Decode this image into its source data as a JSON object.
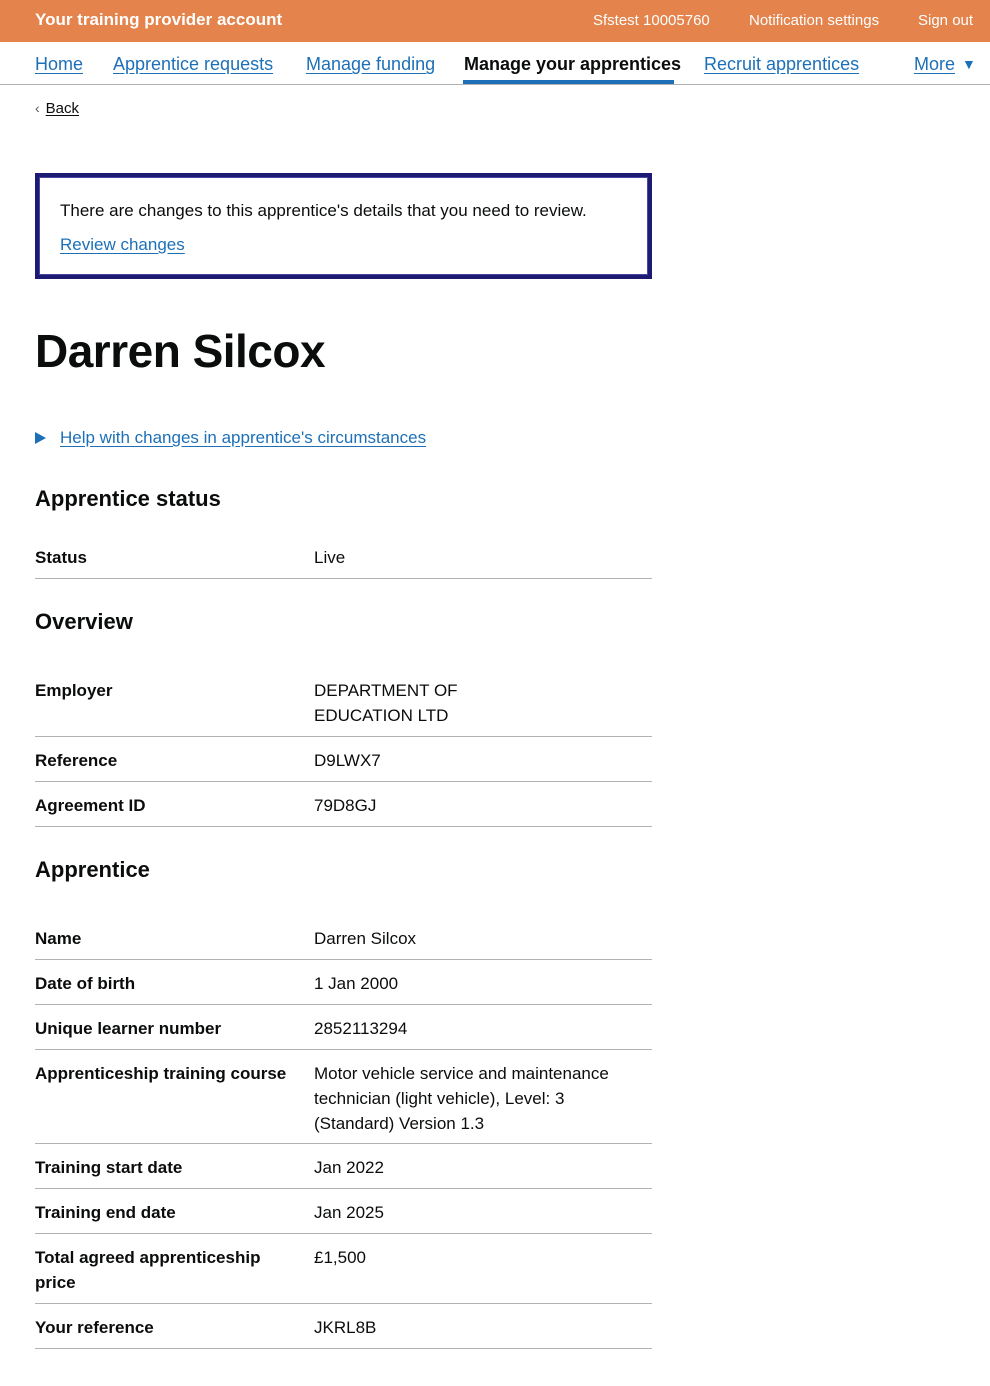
{
  "header": {
    "service_name": "Your training provider account",
    "account": "Sfstest 10005760",
    "notification_settings": "Notification settings",
    "sign_out": "Sign out"
  },
  "nav": {
    "home": "Home",
    "apprentice_requests": "Apprentice requests",
    "manage_funding": "Manage funding",
    "manage_apprentices": "Manage your apprentices",
    "recruit_apprentices": "Recruit apprentices",
    "more": "More",
    "more_icon": "triangle-down-icon"
  },
  "back_link": "Back",
  "banner": {
    "message": "There are changes to this apprentice's details that you need to review.",
    "link": "Review changes"
  },
  "page_title": "Darren Silcox",
  "help_details": "Help with changes in apprentice's circumstances",
  "sections": {
    "status": {
      "heading": "Apprentice status",
      "rows": [
        {
          "key": "Status",
          "value": "Live"
        }
      ]
    },
    "overview": {
      "heading": "Overview",
      "rows": [
        {
          "key": "Employer",
          "value": "DEPARTMENT OF EDUCATION LTD"
        },
        {
          "key": "Reference",
          "value": "D9LWX7"
        },
        {
          "key": "Agreement ID",
          "value": "79D8GJ"
        }
      ]
    },
    "apprentice": {
      "heading": "Apprentice",
      "rows": [
        {
          "key": "Name",
          "value": "Darren Silcox"
        },
        {
          "key": "Date of birth",
          "value": "1 Jan 2000"
        },
        {
          "key": "Unique learner number",
          "value": "2852113294"
        },
        {
          "key": "Apprenticeship training course",
          "value": "Motor vehicle service and maintenance technician (light vehicle), Level: 3 (Standard) Version 1.3"
        },
        {
          "key": "Training start date",
          "value": "Jan 2022"
        },
        {
          "key": "Training end date",
          "value": "Jan 2025"
        },
        {
          "key": "Total agreed apprenticeship price",
          "value": "£1,500"
        },
        {
          "key": "Your reference",
          "value": "JKRL8B"
        }
      ]
    }
  }
}
